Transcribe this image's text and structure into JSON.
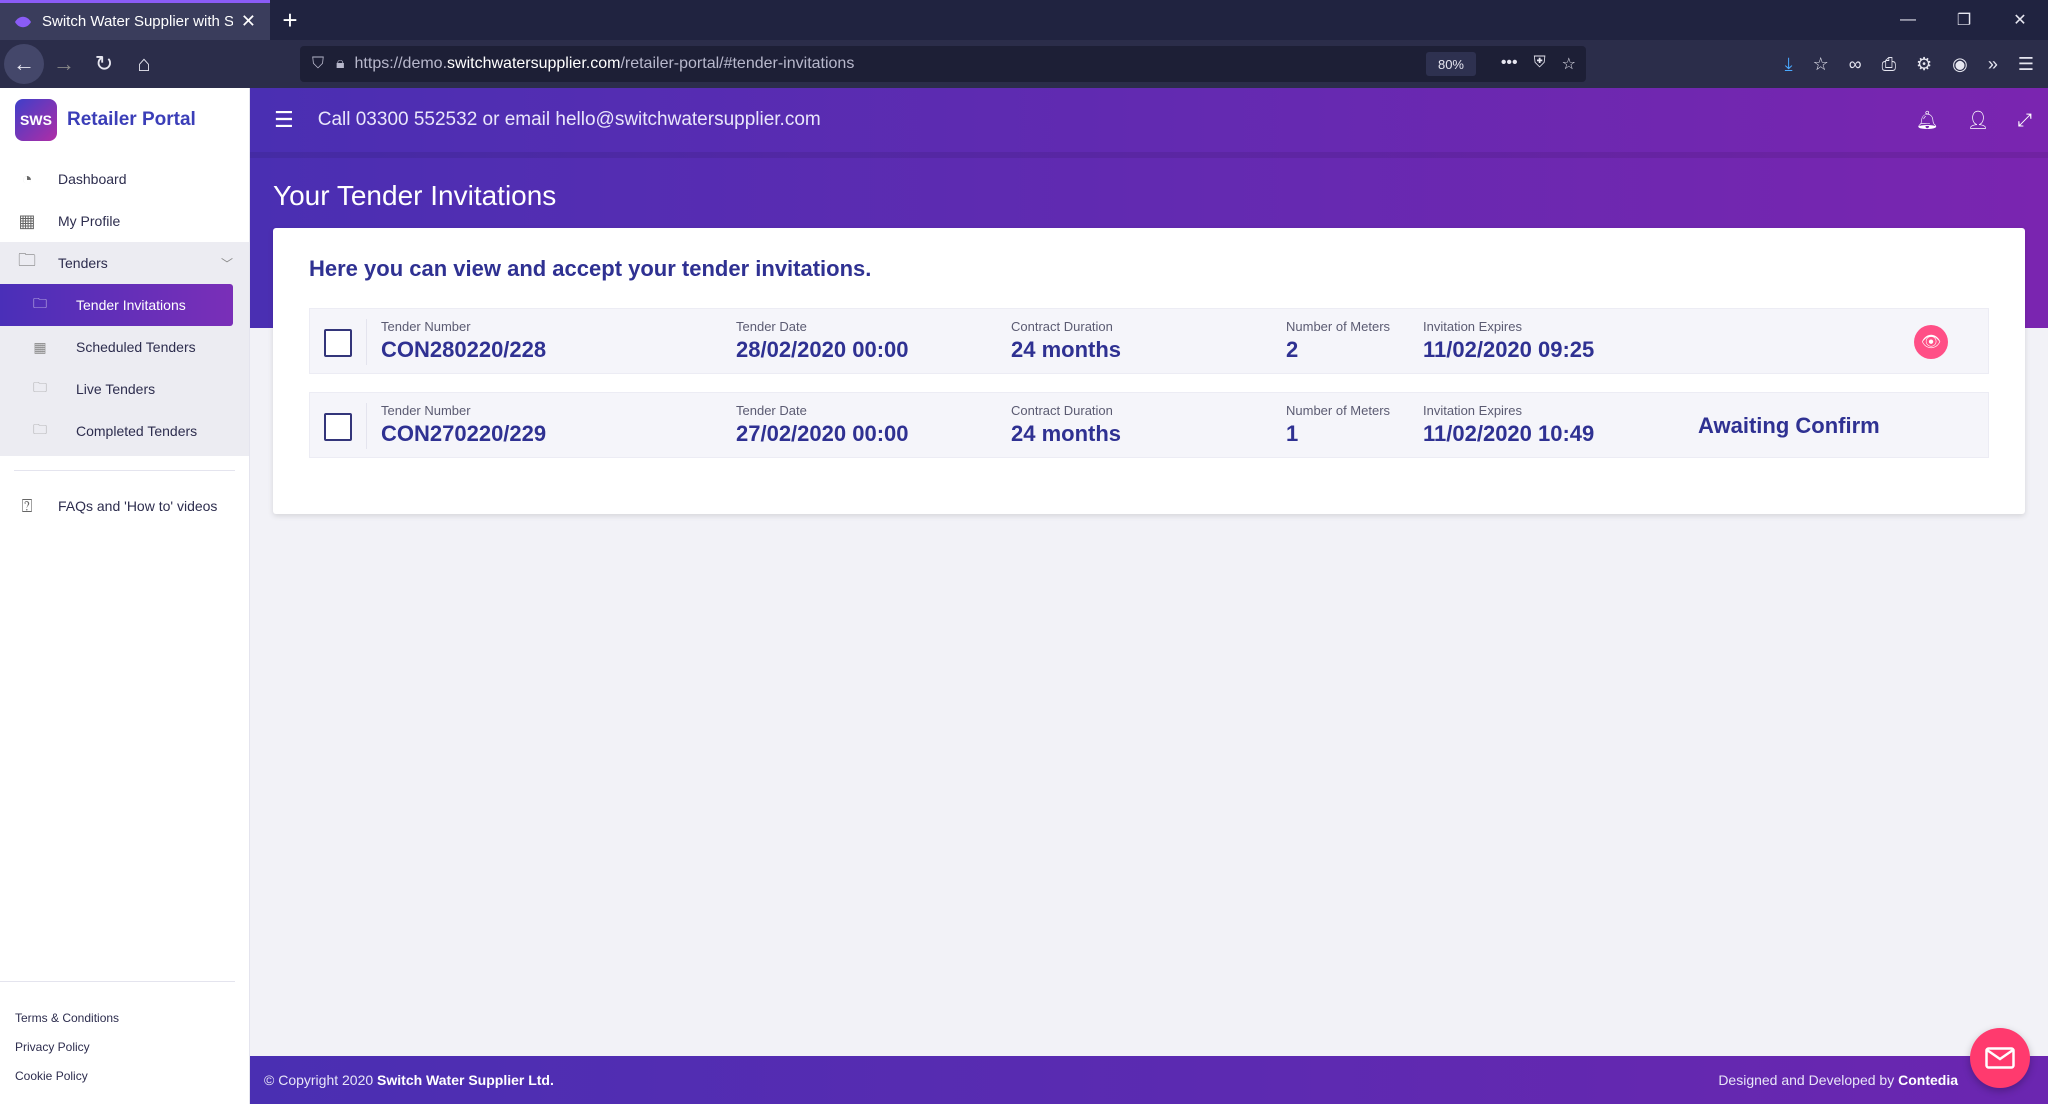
{
  "browser": {
    "tab_title": "Switch Water Supplier with Swi",
    "url_prefix": "https://demo.",
    "url_host": "switchwatersupplier.com",
    "url_path": "/retailer-portal/#tender-invitations",
    "zoom": "80%"
  },
  "app": {
    "logo_text": "SWS",
    "brand_name": "Retailer Portal",
    "contact": "Call 03300 552532 or email hello@switchwatersupplier.com"
  },
  "sidebar": {
    "items": [
      {
        "label": "Dashboard",
        "icon": "speedometer-icon"
      },
      {
        "label": "My Profile",
        "icon": "building-icon"
      },
      {
        "label": "Tenders",
        "icon": "folder-icon"
      }
    ],
    "tenders_sub": [
      {
        "label": "Tender Invitations",
        "active": true
      },
      {
        "label": "Scheduled Tenders"
      },
      {
        "label": "Live Tenders"
      },
      {
        "label": "Completed Tenders"
      }
    ],
    "faq": "FAQs and 'How to' videos",
    "footer_links": [
      "Terms & Conditions",
      "Privacy Policy",
      "Cookie Policy"
    ]
  },
  "page": {
    "title": "Your Tender Invitations",
    "intro": "Here you can view and accept your tender invitations."
  },
  "labels": {
    "tender_number": "Tender Number",
    "tender_date": "Tender Date",
    "contract_duration": "Contract Duration",
    "number_of_meters": "Number of Meters",
    "invitation_expires": "Invitation Expires"
  },
  "tenders": [
    {
      "number": "CON280220/228",
      "date": "28/02/2020 00:00",
      "duration": "24 months",
      "meters": "2",
      "expires": "11/02/2020 09:25",
      "status": ""
    },
    {
      "number": "CON270220/229",
      "date": "27/02/2020 00:00",
      "duration": "24 months",
      "meters": "1",
      "expires": "11/02/2020 10:49",
      "status": "Awaiting Confirm"
    }
  ],
  "footer": {
    "copyright": "© Copyright 2020",
    "company": "Switch Water Supplier Ltd.",
    "designed": "Designed and Developed by",
    "developer": "Contedia"
  },
  "colors": {
    "brand_purple": "#4a2fb2",
    "accent_pink": "#ff4f86",
    "text_navy": "#2f3192"
  }
}
